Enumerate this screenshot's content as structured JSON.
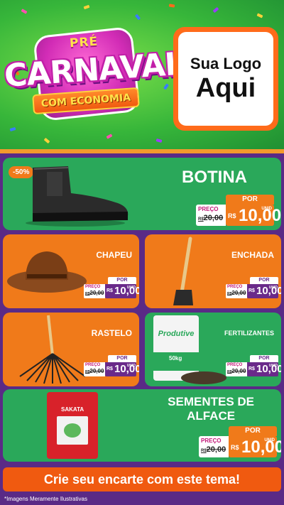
{
  "header": {
    "pre": "PRÉ",
    "title": "CARNAVAL",
    "subtitle": "COM ECONOMIA",
    "logo_line1": "Sua Logo",
    "logo_line2": "Aqui"
  },
  "products": [
    {
      "name": "BOTINA",
      "badge": "-50%",
      "por": "POR",
      "preco": "PREÇO",
      "old_prefix": "R$",
      "old_price": "20,00",
      "currency": "R$",
      "price": "10,00",
      "unit": "UNID"
    },
    {
      "name": "CHAPEU",
      "por": "POR",
      "preco": "PREÇO",
      "old_prefix": "R$",
      "old_price": "20,00",
      "currency": "R$",
      "price": "10,00",
      "unit": "UNID"
    },
    {
      "name": "ENCHADA",
      "por": "POR",
      "preco": "PREÇO",
      "old_prefix": "R$",
      "old_price": "20,00",
      "currency": "R$",
      "price": "10,00",
      "unit": "UNID"
    },
    {
      "name": "RASTELO",
      "por": "POR",
      "preco": "PREÇO",
      "old_prefix": "R$",
      "old_price": "20,00",
      "currency": "R$",
      "price": "10,00",
      "unit": "UNID"
    },
    {
      "name": "FERTILIZANTES",
      "por": "POR",
      "preco": "PREÇO",
      "old_prefix": "R$",
      "old_price": "20,00",
      "currency": "R$",
      "price": "10,00",
      "unit": "UNID",
      "package_brand": "Produtive",
      "package_weight": "50kg"
    },
    {
      "name_line1": "SEMENTES DE",
      "name_line2": "ALFACE",
      "por": "POR",
      "preco": "PREÇO",
      "old_prefix": "R$",
      "old_price": "20,00",
      "currency": "R$",
      "price": "10,00",
      "unit": "UNID",
      "package_brand": "SAKATA"
    }
  ],
  "footer": {
    "cta": "Crie seu encarte com este tema!",
    "disclaimer": "*Imagens Meramente Ilustrativas"
  },
  "colors": {
    "green_card": "#2aa85a",
    "orange_card": "#f07a1a",
    "purple_bg": "#5a2a86",
    "cta": "#f05a10"
  }
}
